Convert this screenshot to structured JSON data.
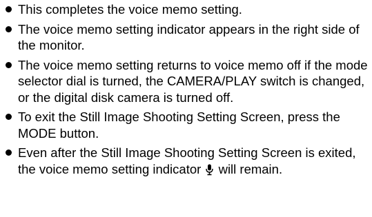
{
  "bullets": [
    {
      "text": "This completes the voice memo setting."
    },
    {
      "text": "The voice memo setting indicator appears in the right side of the monitor."
    },
    {
      "text": "The voice memo setting returns to voice memo off if the mode selector dial is turned, the CAMERA/PLAY switch is changed, or the digital disk camera is turned off."
    },
    {
      "text": "To exit the Still Image Shooting Setting Screen, press the MODE button."
    },
    {
      "text_before_icon": "Even after the Still Image Shooting Setting Screen is exited, the voice memo setting indicator",
      "icon": "microphone-icon",
      "text_after_icon": "will remain."
    }
  ]
}
